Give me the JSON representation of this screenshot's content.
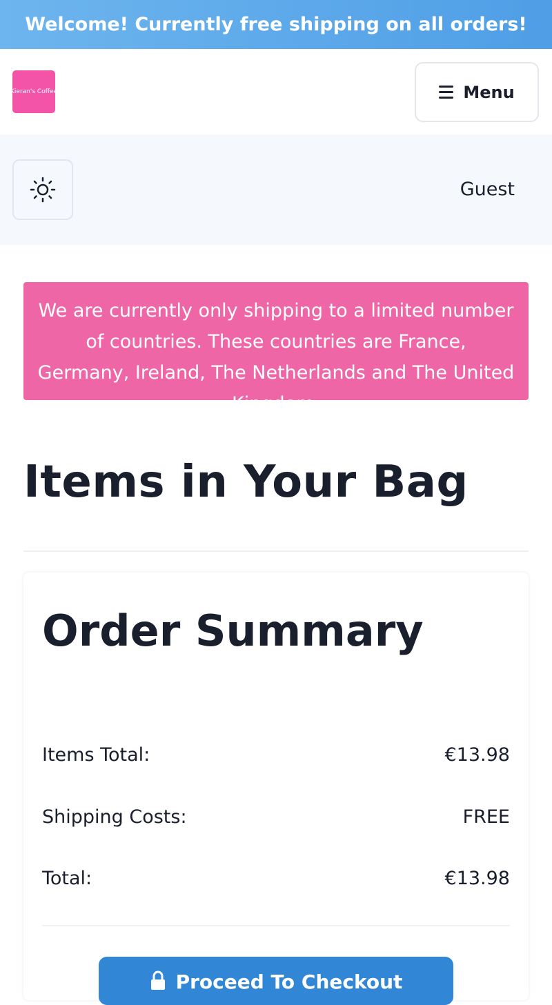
{
  "promo": {
    "text": "Welcome! Currently free shipping on all orders!"
  },
  "header": {
    "logo_text": "Kieran's Coffee",
    "menu_label": "Menu",
    "icons": {
      "menu": "hamburger-icon",
      "theme": "sun-icon",
      "checkout": "lock-icon"
    }
  },
  "subbar": {
    "user_label": "Guest"
  },
  "notice": {
    "text": "We are currently only shipping to a limited number of countries. These countries are France, Germany, Ireland, The Netherlands and The United Kingdom."
  },
  "bag": {
    "title": "Items in Your Bag"
  },
  "summary": {
    "title": "Order Summary",
    "rows": [
      {
        "label": "Items Total:",
        "value": "€13.98"
      },
      {
        "label": "Shipping Costs:",
        "value": "FREE"
      },
      {
        "label": "Total:",
        "value": "€13.98"
      }
    ],
    "checkout_label": "Proceed To Checkout"
  },
  "colors": {
    "promo_gradient_start": "#6db5ee",
    "promo_gradient_end": "#4f9ee6",
    "logo_bg": "#f354a8",
    "notice_bg": "#ee66a6",
    "checkout_bg": "#3186d6",
    "text_dark": "#1a1f2e"
  }
}
